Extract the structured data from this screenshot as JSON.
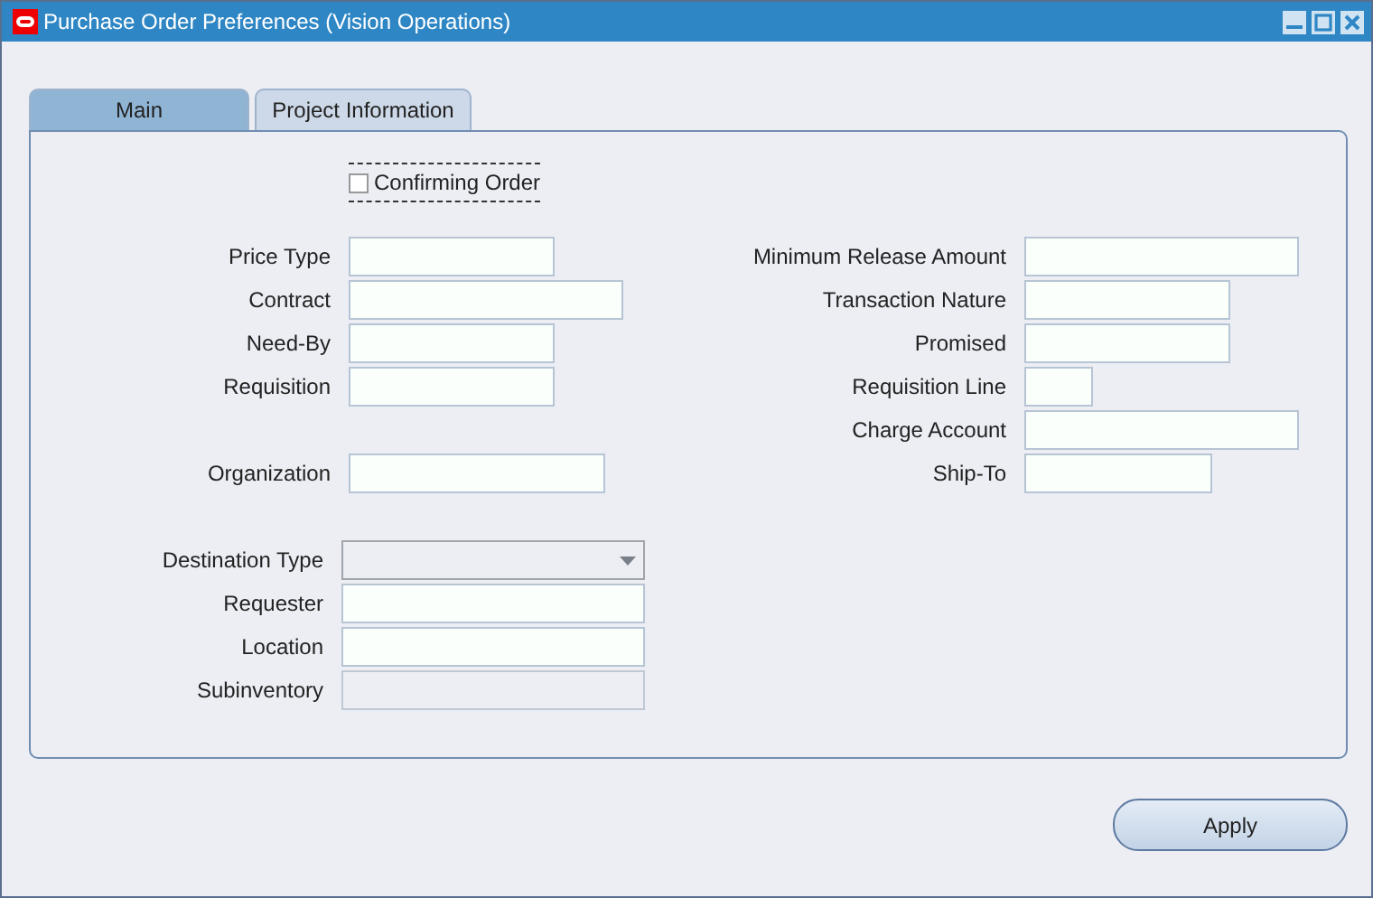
{
  "window": {
    "title": "Purchase Order Preferences (Vision Operations)"
  },
  "tabs": [
    {
      "label": "Main",
      "selected": true
    },
    {
      "label": "Project Information",
      "selected": false
    }
  ],
  "confirming_order": {
    "label": "Confirming Order",
    "checked": false
  },
  "left_groups": [
    [
      {
        "label": "Price Type",
        "kind": "text"
      },
      {
        "label": "Contract",
        "kind": "text"
      },
      {
        "label": "Need-By",
        "kind": "text"
      },
      {
        "label": "Requisition",
        "kind": "text"
      }
    ],
    [
      {
        "label": "Organization",
        "kind": "text"
      }
    ],
    [
      {
        "label": "Destination Type",
        "kind": "select"
      },
      {
        "label": "Requester",
        "kind": "text"
      },
      {
        "label": "Location",
        "kind": "text"
      },
      {
        "label": "Subinventory",
        "kind": "readonly"
      }
    ]
  ],
  "right_fields": [
    {
      "label": "Minimum Release Amount",
      "kind": "text"
    },
    {
      "label": "Transaction Nature",
      "kind": "text"
    },
    {
      "label": "Promised",
      "kind": "text"
    },
    {
      "label": "Requisition Line",
      "kind": "text"
    },
    {
      "label": "Charge Account",
      "kind": "text"
    },
    {
      "label": "Ship-To",
      "kind": "text"
    }
  ],
  "buttons": [
    {
      "label": "Apply"
    }
  ]
}
